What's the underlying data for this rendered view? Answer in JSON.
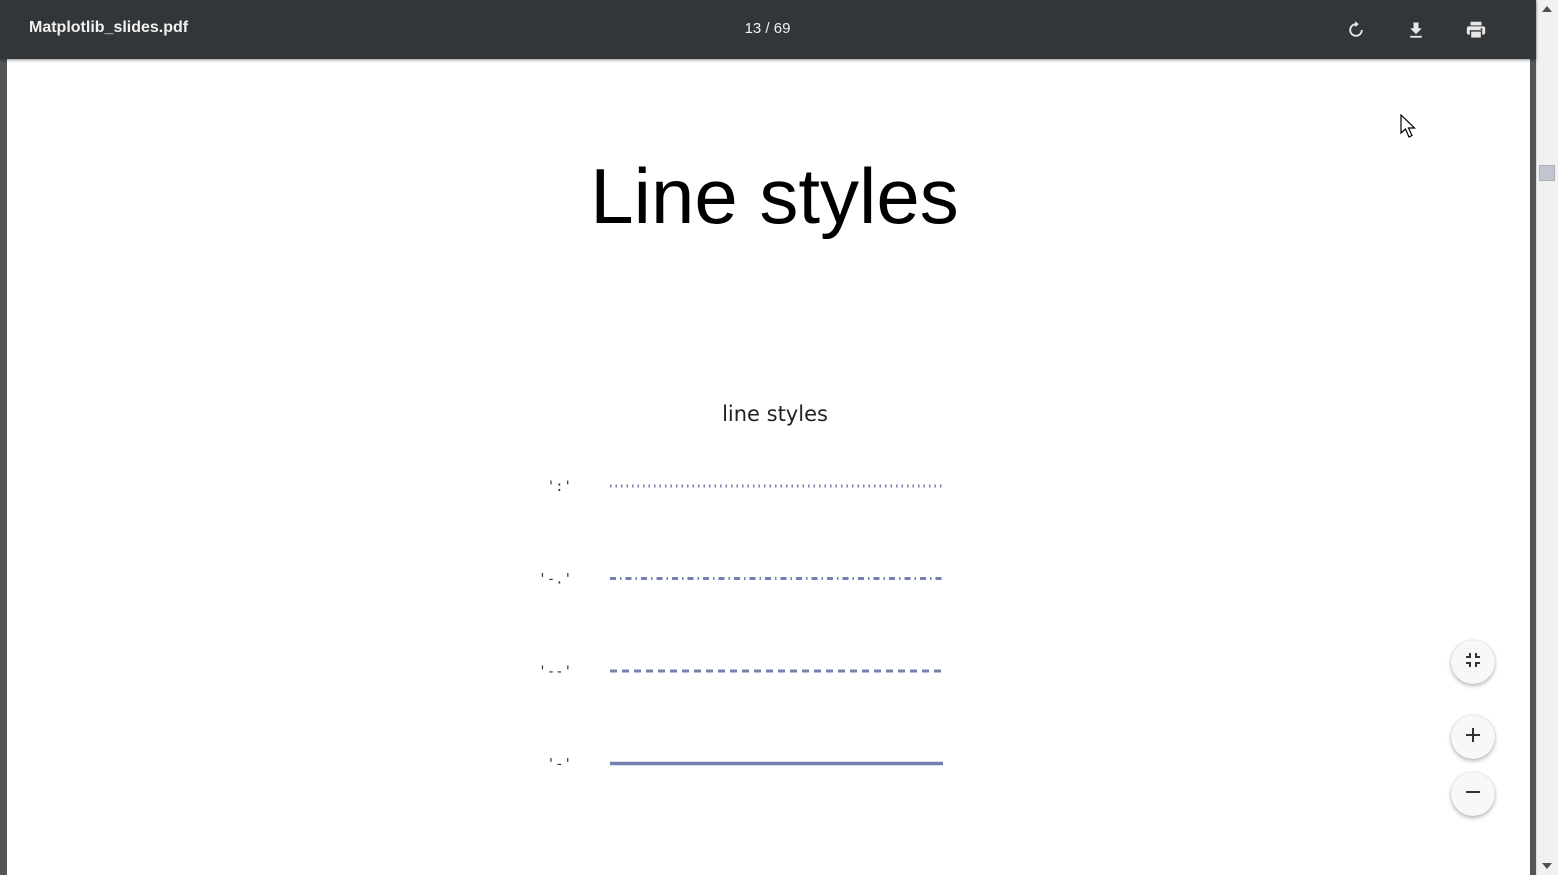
{
  "toolbar": {
    "file_name": "Matplotlib_slides.pdf",
    "page_indicator": "13 / 69",
    "buttons": {
      "rotate": "rotate-icon",
      "download": "download-icon",
      "print": "print-icon"
    }
  },
  "slide": {
    "title": "Line styles"
  },
  "chart_data": {
    "type": "line",
    "title": "line styles",
    "categories": [
      "':'",
      "'-.'",
      "'--'",
      "'-'"
    ],
    "series": [
      {
        "linestyle": ":",
        "x": [
          0,
          1
        ],
        "y": [
          0,
          0
        ]
      },
      {
        "linestyle": "-.",
        "x": [
          0,
          1
        ],
        "y": [
          1,
          1
        ]
      },
      {
        "linestyle": "--",
        "x": [
          0,
          1
        ],
        "y": [
          2,
          2
        ]
      },
      {
        "linestyle": "-",
        "x": [
          0,
          1
        ],
        "y": [
          3,
          3
        ]
      }
    ],
    "axes_visible": false,
    "grid": false,
    "color": "#5c6ba3"
  },
  "zoom_controls": {
    "fit": "fit-page-icon",
    "zoom_in": "zoom-in-icon",
    "zoom_out": "zoom-out-icon"
  },
  "colors": {
    "toolbar_bg": "#323639",
    "viewer_bg": "#525659",
    "line_color": "#5c6ba3"
  }
}
